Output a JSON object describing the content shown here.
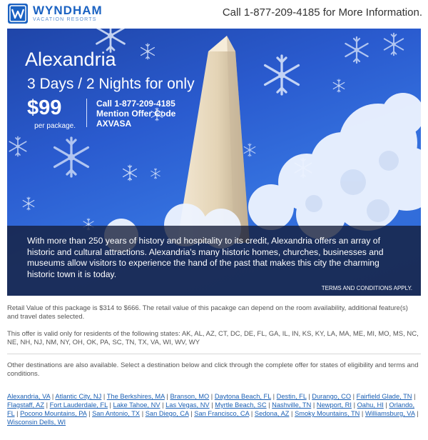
{
  "header": {
    "brand": "WYNDHAM",
    "brand_sub": "VACATION RESORTS",
    "phone_text": "Call 1-877-209-4185 for More Information."
  },
  "hero": {
    "city": "Alexandria",
    "deal": "3 Days / 2 Nights for only",
    "price": "$99",
    "price_unit": "per package.",
    "call_text": "Call 1-877-209-4185",
    "mention_text": "Mention Offer Code",
    "offer_code": "AXVASA",
    "description": "With more than 250 years of history and hospitality to its credit, Alexandria offers an array of historic and cultural attractions. Alexandria's many historic homes, churches, businesses and museums allow visitors to experience the hand of the past that makes this city the charming historic town it is today.",
    "terms": "TERMS AND CONDITIONS APPLY."
  },
  "content": {
    "retail": "Retail Value of this package is $314 to $666. The retail value of this pacakge can depend on the room availability, additional feature(s) and travel dates selected.",
    "residents": "This offer is valid only for residents of the following states: AK, AL, AZ, CT, DC, DE, FL, GA, IL, IN, KS, KY, LA, MA, ME, MI, MO, MS, NC, NE, NH, NJ, NM, NY, OH, OK, PA, SC, TN, TX, VA, WI, WV, WY",
    "other": "Other destinations are also available. Select a destination below and click through the complete offer for states of eligibility and terms and conditions."
  },
  "destinations": [
    "Alexandria, VA",
    "Atlantic City, NJ",
    "The Berkshires, MA",
    "Branson, MO",
    "Daytona Beach, FL",
    "Destin, FL",
    "Durango, CO",
    "Fairfield Glade, TN",
    "Flagstaff, AZ",
    "Fort Lauderdale, FL",
    "Lake Tahoe, NV",
    "Las Vegas, NV",
    "Myrtle Beach, SC",
    "Nashville, TN",
    "Newport, RI",
    "Oahu, HI",
    "Orlando, FL",
    "Pocono Mountains, PA",
    "San Antonio, TX",
    "San Diego, CA",
    "San Francisco, CA",
    "Sedona, AZ",
    "Smoky Mountains, TN",
    "Williamsburg, VA",
    "Wisconsin Dells, WI"
  ],
  "colors": {
    "brand_blue": "#1a62c2",
    "link_blue": "#1a5fb4",
    "hero_blue": "#2a5bcf"
  }
}
